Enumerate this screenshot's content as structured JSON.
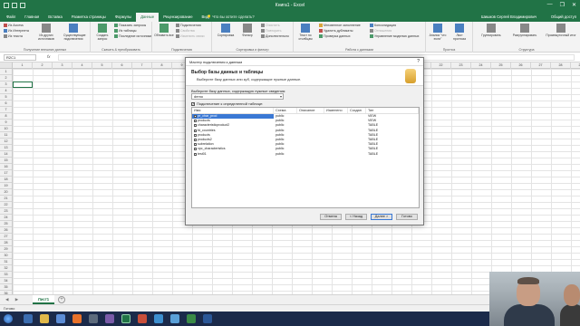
{
  "window": {
    "title": "Книга1 - Excel",
    "controls": [
      "—",
      "❐",
      "✕"
    ]
  },
  "tabs": {
    "items": [
      "Файл",
      "Главная",
      "Вставка",
      "Разметка страницы",
      "Формулы",
      "Данные",
      "Рецензирование",
      "Вид"
    ],
    "active": "Данные",
    "tell_me": "Что вы хотите сделать?",
    "user": "Шишков Сергей Владимирович",
    "share": "Общий доступ"
  },
  "ribbon": {
    "get_external": {
      "items": [
        "Из Access",
        "Из Интернета",
        "Из текста",
        "Из других источников",
        "Существующие подключения"
      ],
      "label": "Получение внешних данных"
    },
    "get_transform": {
      "new_query": "Создать запрос",
      "items": [
        "Показать запросы",
        "Из таблицы",
        "Последние источники"
      ],
      "label": "Скачать & преобразовать"
    },
    "connections": {
      "refresh": "Обновить все",
      "items": [
        "Подключения",
        "Свойства",
        "Изменить связи"
      ],
      "label": "Подключения"
    },
    "sort_filter": {
      "items": [
        "Сортировка",
        "Фильтр",
        "Очистить",
        "Повторить",
        "Дополнительно"
      ],
      "label": "Сортировка и фильтр"
    },
    "data_tools": {
      "text_to_columns": "Текст по столбцам",
      "items": [
        "Мгновенное заполнение",
        "Удалить дубликаты",
        "Проверка данных",
        "Консолидация",
        "Отношения",
        "Управление моделью данных"
      ],
      "label": "Работа с данными"
    },
    "forecast": {
      "items": [
        "Анализ \"что если\"",
        "Лист прогноза"
      ],
      "label": "Прогноз"
    },
    "outline": {
      "items": [
        "Группировать",
        "Разгруппировать",
        "Промежуточный итог"
      ],
      "label": "Структура"
    }
  },
  "formula_bar": {
    "name_box": "R2C1",
    "fx": "fx",
    "value": ""
  },
  "grid": {
    "columns": [
      "1",
      "2",
      "3",
      "4",
      "5",
      "6",
      "7",
      "8",
      "9",
      "10",
      "11",
      "12",
      "13",
      "14",
      "15",
      "16",
      "17",
      "18",
      "19",
      "20",
      "21",
      "22",
      "23",
      "24",
      "25",
      "26",
      "27",
      "28",
      "29"
    ],
    "rows": [
      "1",
      "2",
      "3",
      "4",
      "5",
      "6",
      "7",
      "8",
      "9",
      "10",
      "11",
      "12",
      "13",
      "14",
      "15",
      "16",
      "17",
      "18",
      "19",
      "20",
      "21",
      "22",
      "23",
      "24",
      "25",
      "26",
      "27",
      "28",
      "29",
      "30",
      "31",
      "32",
      "33",
      "34",
      "35",
      "36"
    ]
  },
  "sheets": {
    "nav": "◀ ▶",
    "active": "Лист1",
    "add": "+"
  },
  "status": {
    "text": "Готово"
  },
  "dialog": {
    "title": "Мастер подключения к данным",
    "close": "?",
    "heading": "Выбор базы данных и таблицы",
    "subheading": "Выберите базу данных или куб, содержащие нужные данные.",
    "db_label": "Выберите базу данных, содержащую нужные сведения:",
    "db_value": "demo",
    "db_arrow": "▾",
    "connect_specific": "Подключение к определенной таблице:",
    "connect_checked": "✓",
    "columns": {
      "name": "Имя",
      "schema": "Схема",
      "description": "Описание",
      "modified": "Изменено",
      "created": "Создан",
      "type": "Тип"
    },
    "rows": [
      {
        "name": "pr_char_prod",
        "schema": "public",
        "type": "VIEW",
        "selected": true
      },
      {
        "name": "products",
        "schema": "public",
        "type": "VIEW",
        "selected": false
      },
      {
        "name": "characteristicproduct2",
        "schema": "public",
        "type": "TABLE",
        "selected": false
      },
      {
        "name": "fd_countries",
        "schema": "public",
        "type": "TABLE",
        "selected": false
      },
      {
        "name": "products",
        "schema": "public",
        "type": "TABLE",
        "selected": false
      },
      {
        "name": "products2",
        "schema": "public",
        "type": "TABLE",
        "selected": false
      },
      {
        "name": "subrelation",
        "schema": "public",
        "type": "TABLE",
        "selected": false
      },
      {
        "name": "vpc_characteristics",
        "schema": "public",
        "type": "TABLE",
        "selected": false
      },
      {
        "name": "test01",
        "schema": "public",
        "type": "TABLE",
        "selected": false
      }
    ],
    "buttons": {
      "cancel": "Отмена",
      "back": "< Назад",
      "next": "Далее >",
      "finish": "Готово"
    }
  },
  "taskbar": {
    "time": "10:59",
    "date": "15.03.2017"
  }
}
